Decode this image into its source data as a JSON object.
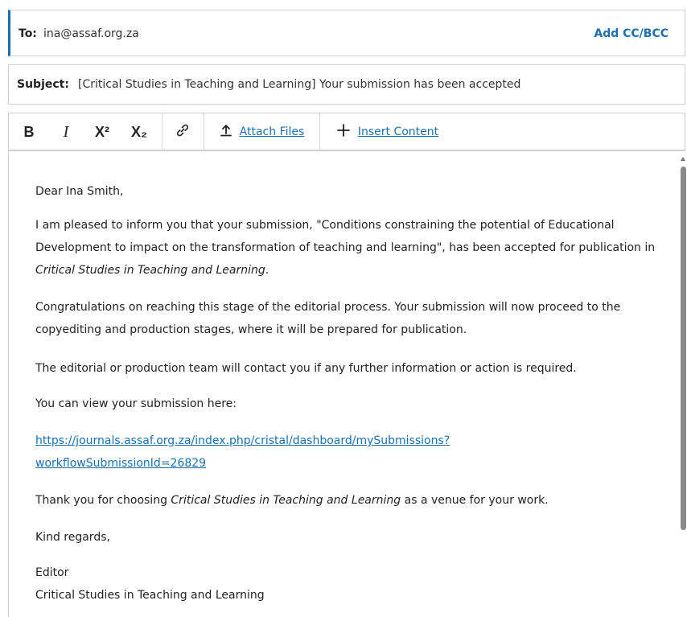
{
  "header": {
    "to_label": "To:",
    "to_value": "ina@assaf.org.za",
    "add_cc_label": "Add CC/BCC"
  },
  "subject": {
    "label": "Subject:",
    "value": "[Critical Studies in Teaching and Learning] Your submission has been accepted"
  },
  "toolbar": {
    "bold_label": "B",
    "italic_label": "I",
    "superscript_label": "X²",
    "subscript_label": "X₂",
    "attach_label": "Attach Files",
    "insert_label": "Insert Content"
  },
  "email": {
    "greeting": "Dear Ina Smith,",
    "p1_a": "I am pleased to inform you that your submission, \"Conditions constraining the potential of Educational Development to impact on the transformation of teaching and learning\", has been accepted for publication in ",
    "p1_journal": "Critical Studies in Teaching and Learning",
    "p1_end": ".",
    "p2": "Congratulations on reaching this stage of the editorial process. Your submission will now proceed to the copyediting and production stages, where it will be prepared for publication.",
    "p3": "The editorial or production team will contact you if any further information or action is required.",
    "p4": "You can view your submission here:",
    "link_line1": "https://journals.assaf.org.za/index.php/cristal/dashboard/mySubmissions?",
    "link_line2": "workflowSubmissionId=26829",
    "p5_a": "Thank you for choosing ",
    "p5_journal": "Critical Studies in Teaching and Learning",
    "p5_b": " as a venue for your work.",
    "regards": "Kind regards,",
    "sig_role": "Editor",
    "sig_journal": "Critical Studies in Teaching and Learning"
  },
  "colors": {
    "accent": "#1c6fb1",
    "border": "#cfcfcf",
    "scrollbar": "#8a8a8a"
  }
}
